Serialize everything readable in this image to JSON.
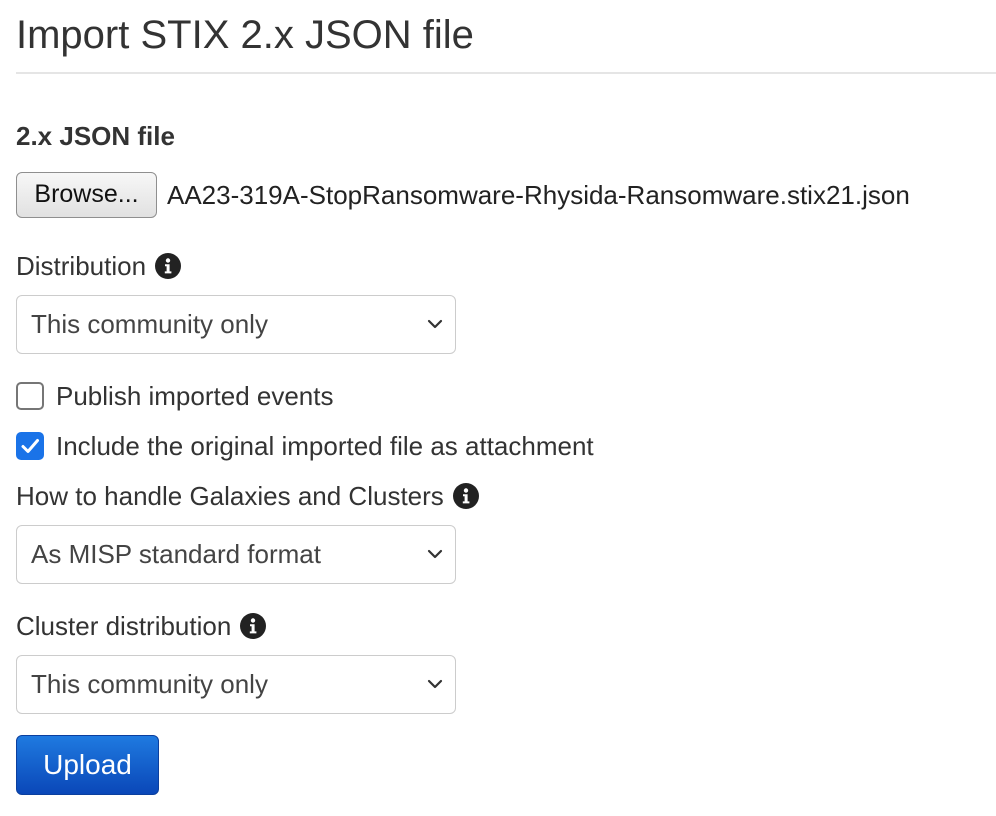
{
  "page": {
    "title": "Import STIX 2.x JSON file"
  },
  "file": {
    "label": "2.x JSON file",
    "browse_label": "Browse...",
    "selected_file": "AA23-319A-StopRansomware-Rhysida-Ransomware.stix21.json"
  },
  "distribution": {
    "label": "Distribution",
    "icon": "info-circle-icon",
    "value": "This community only"
  },
  "publish": {
    "label": "Publish imported events",
    "checked": false
  },
  "include_original": {
    "label": "Include the original imported file as attachment",
    "checked": true
  },
  "galaxies": {
    "label": "How to handle Galaxies and Clusters",
    "icon": "info-circle-icon",
    "value": "As MISP standard format"
  },
  "cluster_distribution": {
    "label": "Cluster distribution",
    "icon": "info-circle-icon",
    "value": "This community only"
  },
  "actions": {
    "upload_label": "Upload"
  },
  "colors": {
    "accent": "#1a73e8",
    "primary_button": "#1560cf",
    "text": "#333333",
    "border": "#cccccc"
  }
}
